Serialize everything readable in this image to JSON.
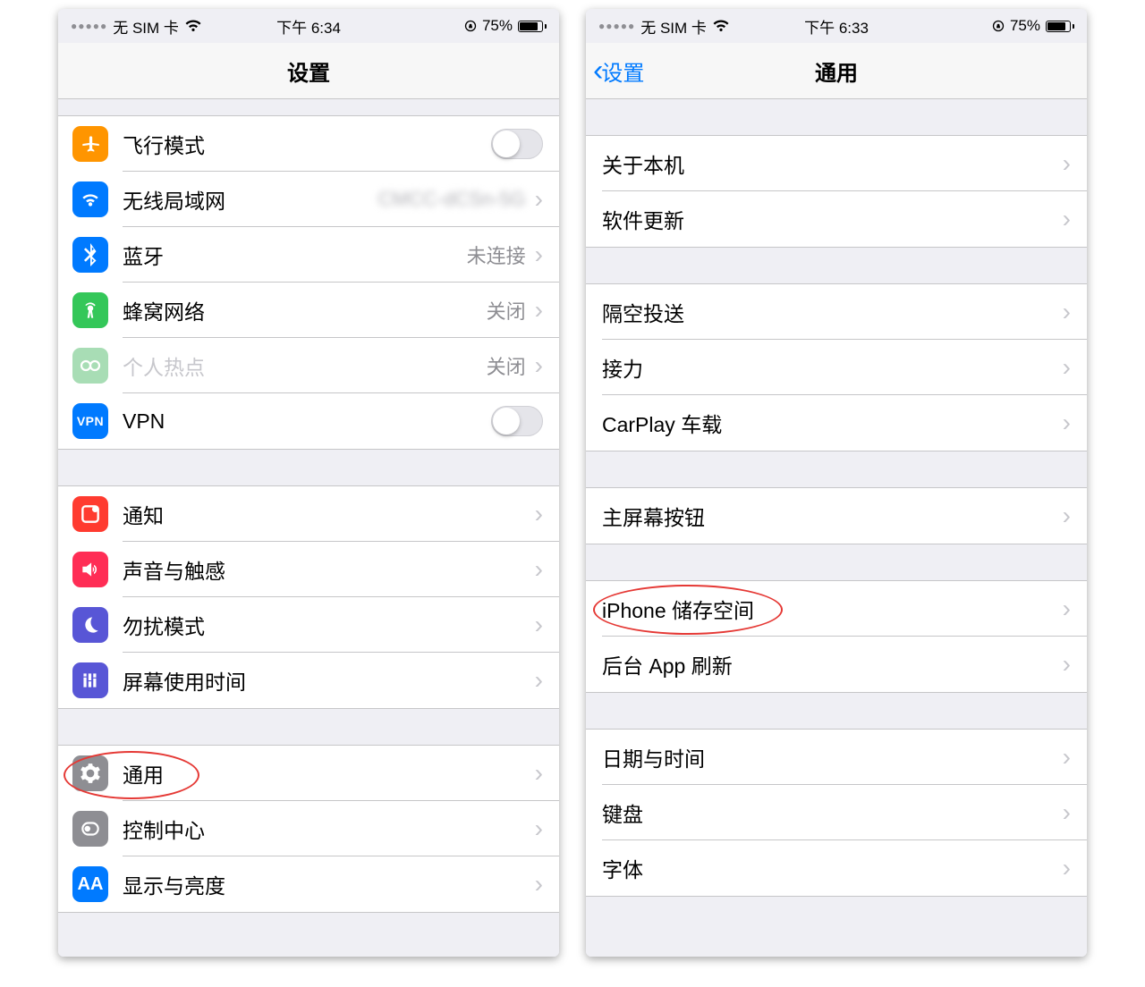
{
  "screens": [
    {
      "statusbar": {
        "carrier": "无 SIM 卡",
        "time": "下午 6:34",
        "battery_pct": "75%"
      },
      "nav": {
        "title": "设置"
      },
      "groups": [
        {
          "rows": [
            {
              "icon": "airplane-icon",
              "label": "飞行模式",
              "kind": "switch"
            },
            {
              "icon": "wifi-icon",
              "label": "无线局域网",
              "value": "CMCC-dCSn-5G",
              "blurred": true,
              "kind": "disclosure"
            },
            {
              "icon": "bluetooth-icon",
              "label": "蓝牙",
              "value": "未连接",
              "kind": "disclosure"
            },
            {
              "icon": "cellular-icon",
              "label": "蜂窝网络",
              "value": "关闭",
              "kind": "disclosure"
            },
            {
              "icon": "hotspot-icon",
              "label": "个人热点",
              "value": "关闭",
              "kind": "disclosure",
              "disabled": true
            },
            {
              "icon": "vpn-icon",
              "label": "VPN",
              "kind": "switch"
            }
          ]
        },
        {
          "rows": [
            {
              "icon": "notifications-icon",
              "label": "通知",
              "kind": "disclosure"
            },
            {
              "icon": "sounds-icon",
              "label": "声音与触感",
              "kind": "disclosure"
            },
            {
              "icon": "dnd-icon",
              "label": "勿扰模式",
              "kind": "disclosure"
            },
            {
              "icon": "screentime-icon",
              "label": "屏幕使用时间",
              "kind": "disclosure"
            }
          ]
        },
        {
          "rows": [
            {
              "icon": "general-icon",
              "label": "通用",
              "kind": "disclosure",
              "circled": true
            },
            {
              "icon": "control-center-icon",
              "label": "控制中心",
              "kind": "disclosure"
            },
            {
              "icon": "display-icon",
              "label": "显示与亮度",
              "kind": "disclosure"
            }
          ]
        }
      ]
    },
    {
      "statusbar": {
        "carrier": "无 SIM 卡",
        "time": "下午 6:33",
        "battery_pct": "75%"
      },
      "nav": {
        "title": "通用",
        "back": "设置"
      },
      "groups": [
        {
          "rows": [
            {
              "label": "关于本机",
              "kind": "disclosure"
            },
            {
              "label": "软件更新",
              "kind": "disclosure"
            }
          ]
        },
        {
          "rows": [
            {
              "label": "隔空投送",
              "kind": "disclosure"
            },
            {
              "label": "接力",
              "kind": "disclosure"
            },
            {
              "label": "CarPlay 车载",
              "kind": "disclosure"
            }
          ]
        },
        {
          "rows": [
            {
              "label": "主屏幕按钮",
              "kind": "disclosure"
            }
          ]
        },
        {
          "rows": [
            {
              "label": "iPhone 储存空间",
              "kind": "disclosure",
              "circled": true
            },
            {
              "label": "后台 App 刷新",
              "kind": "disclosure"
            }
          ]
        },
        {
          "rows": [
            {
              "label": "日期与时间",
              "kind": "disclosure"
            },
            {
              "label": "键盘",
              "kind": "disclosure"
            },
            {
              "label": "字体",
              "kind": "disclosure"
            }
          ]
        }
      ]
    }
  ]
}
